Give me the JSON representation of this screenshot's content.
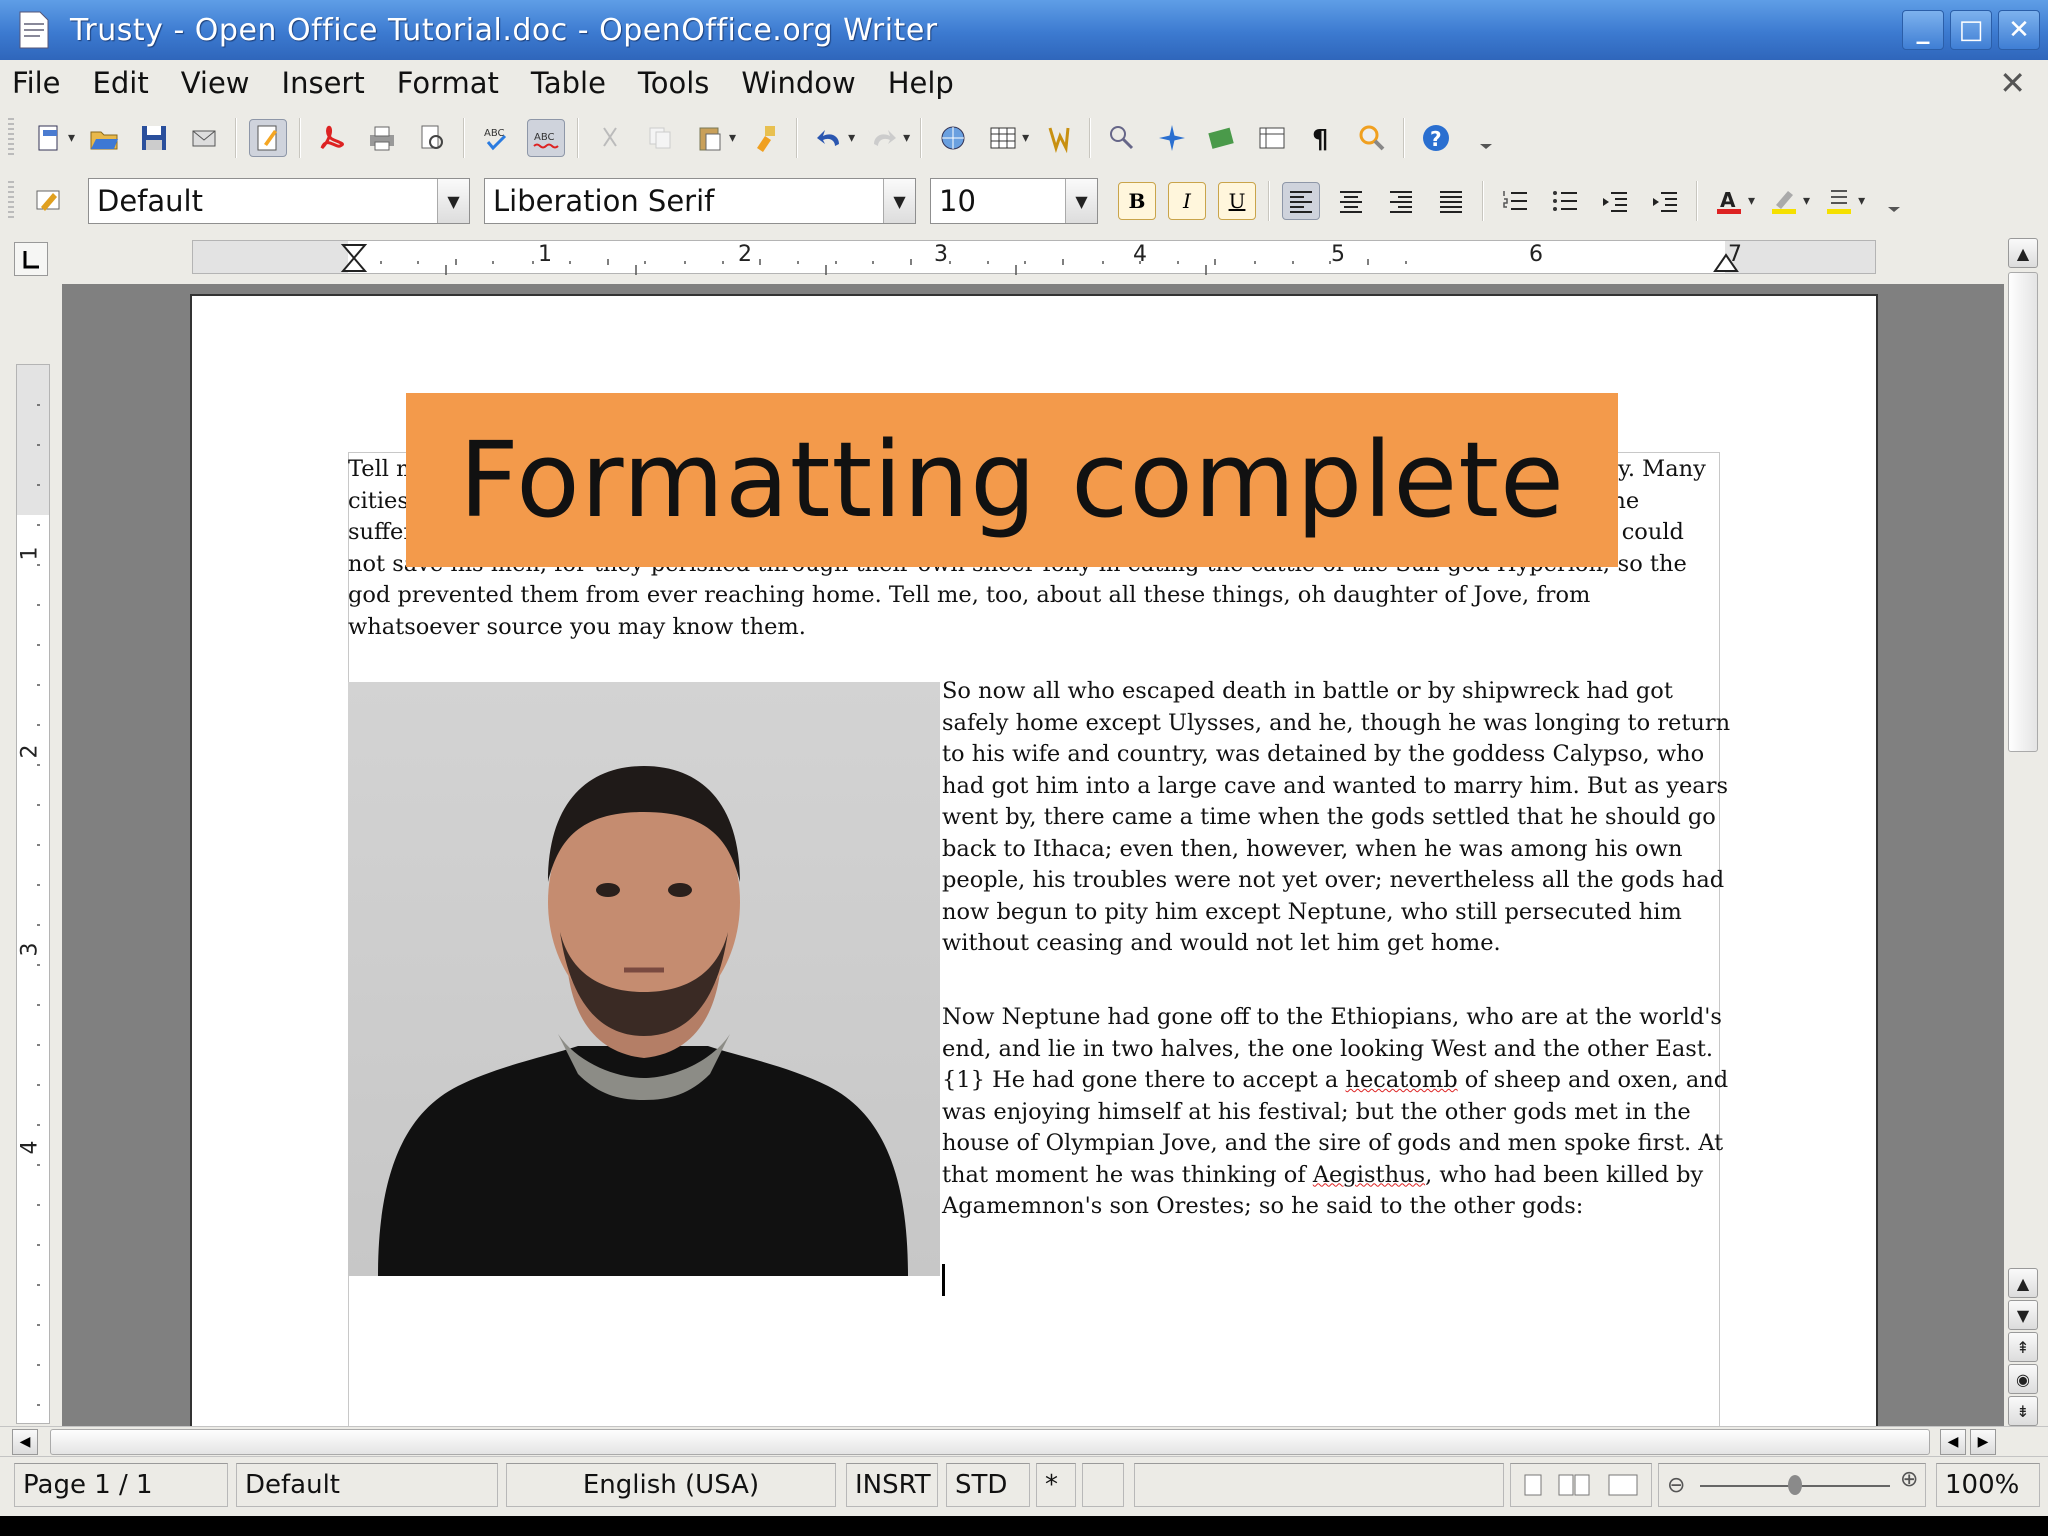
{
  "window": {
    "title": "Trusty - Open Office Tutorial.doc - OpenOffice.org Writer",
    "buttons": {
      "minimize": "_",
      "maximize": "□",
      "close": "✕"
    }
  },
  "menu": {
    "items": [
      {
        "label": "File"
      },
      {
        "label": "Edit"
      },
      {
        "label": "View"
      },
      {
        "label": "Insert"
      },
      {
        "label": "Format"
      },
      {
        "label": "Table"
      },
      {
        "label": "Tools"
      },
      {
        "label": "Window"
      },
      {
        "label": "Help"
      }
    ],
    "close_doc": "✕"
  },
  "formatting": {
    "paragraph_style": "Default",
    "font_name": "Liberation Serif",
    "font_size": "10",
    "bold_label": "B",
    "italic_label": "I",
    "underline_label": "U"
  },
  "ruler": {
    "h_numbers": [
      "1",
      "2",
      "3",
      "4",
      "5",
      "6",
      "7"
    ],
    "v_numbers": [
      "1",
      "2",
      "3",
      "4"
    ]
  },
  "document": {
    "para1": "Tell me, O Muse, of that ingenious hero who travelled far and wide after he had sacked the famous town of Troy. Many cities did he visit, and many were the nations with whose manners and customs he was acquainted; moreover he suffered much by sea while trying to save his own life and bring his men safely home; but do what he might he could not save his men, for they perished through their own sheer folly in eating the cattle of the Sun-god Hyperion; so the god prevented them from ever reaching home. Tell me, too, about all these things, oh daughter of Jove, from whatsoever source you may know them.",
    "para2": "So now all who escaped death in battle or by shipwreck had got safely home except Ulysses, and he, though he was longing to return to his wife and country, was detained by the goddess Calypso, who had got him into a large cave and wanted to marry him. But as years went by, there came a time when the gods settled that he should go back to Ithaca; even then, however, when he was among his own people, his troubles were not yet over; nevertheless all the gods had now begun to pity him except Neptune, who still persecuted him without ceasing and would not let him get home.",
    "para3_a": "Now Neptune had gone off to the Ethiopians, who are at the world's end, and lie in two halves, the one looking West and the other East. {1} He had gone there to accept a ",
    "para3_word1": "hecatomb",
    "para3_b": " of sheep and oxen, and was enjoying himself at his festival; but the other gods met in the house of Olympian Jove, and the sire of gods and men spoke first. At that moment he was thinking of ",
    "para3_word2": "Aegisthus",
    "para3_c": ", who had been killed by Agamemnon's son Orestes; so he said to the other gods:"
  },
  "overlay": {
    "caption": "Formatting complete"
  },
  "status": {
    "page": "Page 1 / 1",
    "style": "Default",
    "language": "English (USA)",
    "insert_mode": "INSRT",
    "selection_mode": "STD",
    "modified": "*",
    "zoom": "100%"
  }
}
